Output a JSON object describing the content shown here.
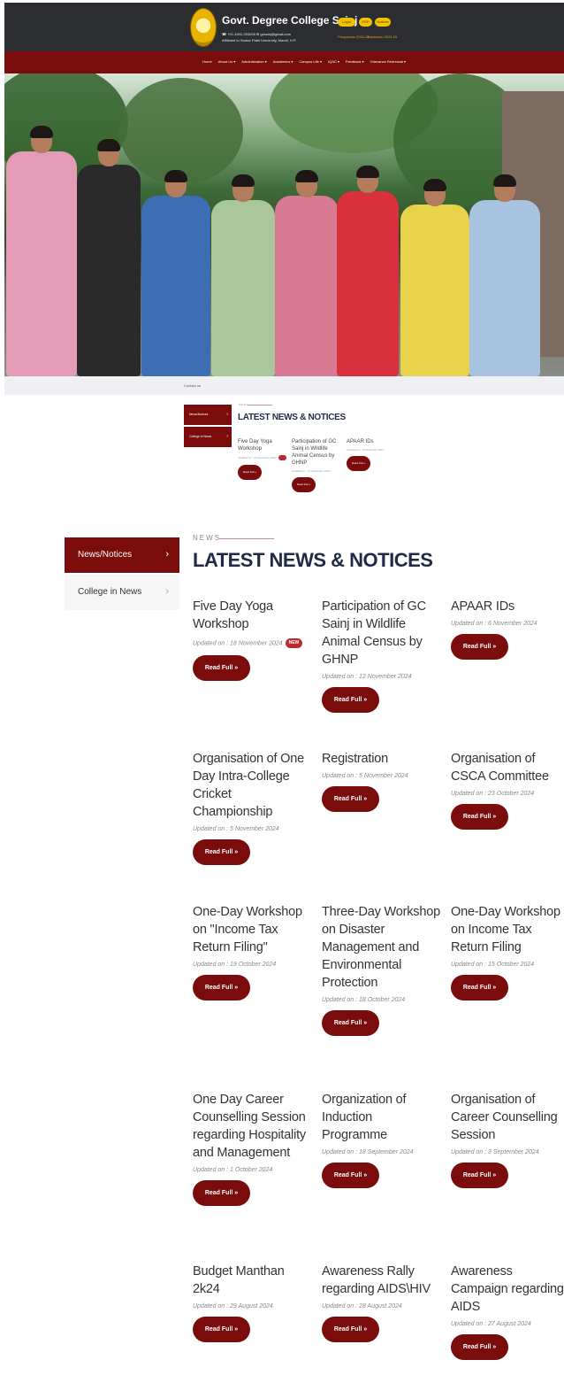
{
  "header": {
    "title": "Govt. Degree College Sainj",
    "contact": "☎ +91-1902-293028 ✉ gcsainj@gmail.com",
    "affiliation": "Affiliated to Sardar Patel University, Mandi, H.P.",
    "buttons": [
      "Login",
      "ERP",
      "Notices"
    ],
    "links": [
      "Prospectus 2024-25",
      "Admission 2024-25"
    ]
  },
  "nav": {
    "items": [
      "Home",
      "About Us ▾",
      "Administration ▾",
      "Academics ▾",
      "Campus Life ▾",
      "IQAC ▾",
      "Feedback ▾",
      "Grievance Redressal ▾"
    ]
  },
  "breadcrumb": "Contact us",
  "mini": {
    "tabs": [
      "News/Notices",
      "College in News"
    ],
    "kicker": "NEWS",
    "heading": "LATEST NEWS & NOTICES",
    "cards": [
      {
        "title": "Five Day Yoga Workshop",
        "date": "Updated on : 18 November 2024",
        "button": "Read Full »"
      },
      {
        "title": "Participation of GC Sainj in Wildlife Animal Census by GHNP",
        "date": "Updated on : 12 November 2024",
        "button": "Read Full »"
      },
      {
        "title": "APAAR IDs",
        "date": "Updated on : 6 November 2024",
        "button": "Read Full »"
      }
    ]
  },
  "news": {
    "tabs": [
      "News/Notices",
      "College in News"
    ],
    "kicker": "NEWS",
    "heading": "LATEST NEWS & NOTICES",
    "new_badge": "NEW",
    "cards": [
      {
        "title": "Five Day Yoga Workshop",
        "date": "Updated on : 18 November 2024",
        "button": "Read Full »"
      },
      {
        "title": "Participation of GC Sainj in Wildlife Animal Census by GHNP",
        "date": "Updated on : 12 November 2024",
        "button": "Read Full »"
      },
      {
        "title": "APAAR IDs",
        "date": "Updated on : 6 November 2024",
        "button": "Read Full »"
      },
      {
        "title": "Organisation of One Day Intra-College Cricket Championship",
        "date": "Updated on : 5 November 2024",
        "button": "Read Full »"
      },
      {
        "title": "Registration",
        "date": "Updated on : 5 November 2024",
        "button": "Read Full »"
      },
      {
        "title": "Organisation of CSCA Committee",
        "date": "Updated on : 23 October 2024",
        "button": "Read Full »"
      },
      {
        "title": "One-Day Workshop on \"Income Tax Return Filing\"",
        "date": "Updated on : 19 October 2024",
        "button": "Read Full »"
      },
      {
        "title": "Three-Day Workshop on Disaster Management and Environmental Protection",
        "date": "Updated on : 18 October 2024",
        "button": "Read Full »"
      },
      {
        "title": "One-Day Workshop on Income Tax Return Filing",
        "date": "Updated on : 15 October 2024",
        "button": "Read Full »"
      },
      {
        "title": "One Day Career Counselling Session regarding Hospitality and Management",
        "date": "Updated on : 1 October 2024",
        "button": "Read Full »"
      },
      {
        "title": "Organization of Induction Programme",
        "date": "Updated on : 18 September 2024",
        "button": "Read Full »"
      },
      {
        "title": "Organisation of Career Counselling Session",
        "date": "Updated on : 3 September 2024",
        "button": "Read Full »"
      },
      {
        "title": "Budget Manthan 2k24",
        "date": "Updated on : 29 August 2024",
        "button": "Read Full »"
      },
      {
        "title": "Awareness Rally regarding AIDS\\HIV",
        "date": "Updated on : 28 August 2024",
        "button": "Read Full »"
      },
      {
        "title": "Awareness Campaign regarding AIDS",
        "date": "Updated on : 27 August 2024",
        "button": "Read Full »"
      }
    ]
  },
  "colors": {
    "brand": "#7a0c0c",
    "header_bg": "#2b2d31",
    "accent": "#f3c200",
    "heading": "#1f2a44"
  }
}
